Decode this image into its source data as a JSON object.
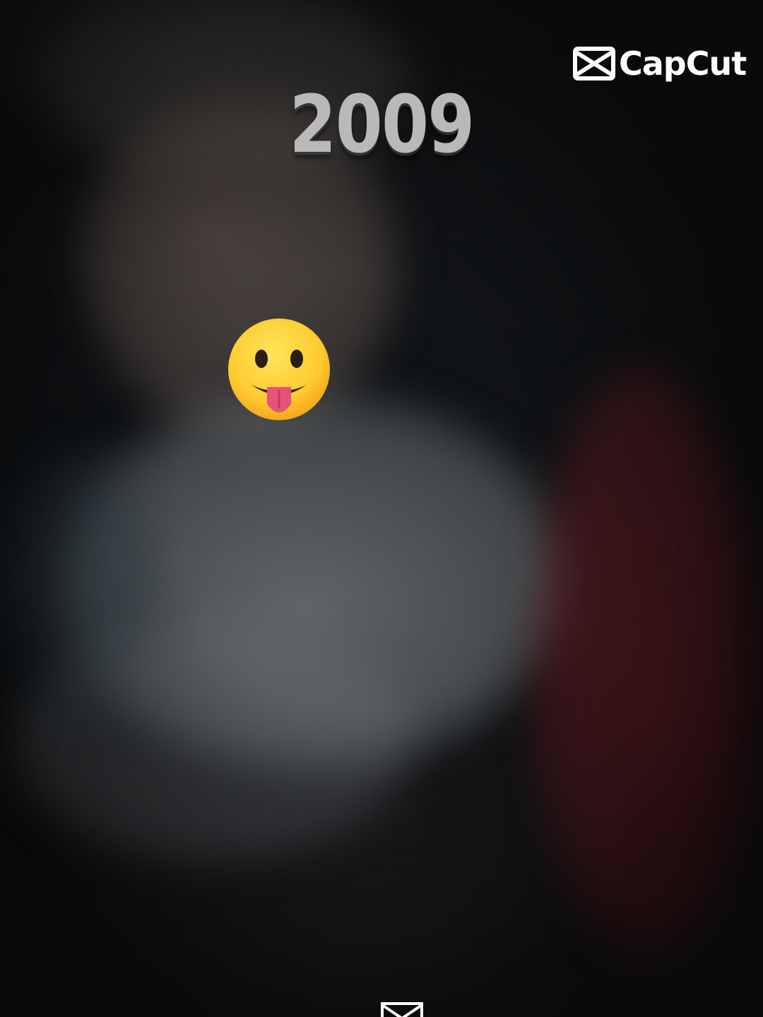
{
  "overlay": {
    "year_text": "2009",
    "watermark_text": "CapCut"
  },
  "icons": {
    "watermark": "capcut-logo-icon",
    "sticker": "face-with-tongue-emoji-icon",
    "bottom": "capcut-mark-icon"
  },
  "colors": {
    "year_text": "#b9b9b9",
    "watermark": "#ffffff",
    "emoji_face": "#ffcb2f"
  }
}
